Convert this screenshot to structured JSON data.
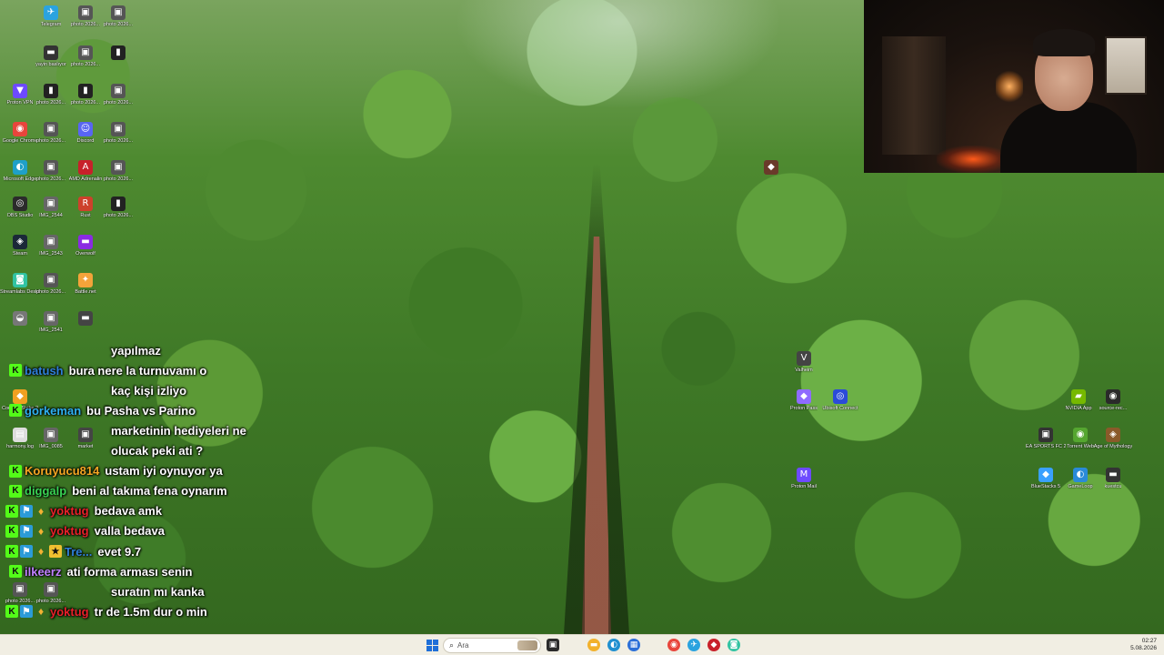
{
  "desktop": {
    "icons": [
      {
        "label": "Telegram",
        "glyph": "✈",
        "color": "#2aa3df"
      },
      {
        "label": "photo 2026...",
        "glyph": "▣",
        "color": "#555555"
      },
      {
        "label": "photo 2026...",
        "glyph": "▣",
        "color": "#555555"
      },
      {
        "label": "",
        "glyph": "▮",
        "color": "#222222"
      },
      {
        "label": "yayin baslıyor",
        "glyph": "▬",
        "color": "#333333"
      },
      {
        "label": "photo 2026...",
        "glyph": "▣",
        "color": "#555555"
      },
      {
        "label": "photo 2026...",
        "glyph": "▣",
        "color": "#555555"
      },
      {
        "label": "Proton VPN",
        "glyph": "▼",
        "color": "#6d4aff"
      },
      {
        "label": "photo 2026...",
        "glyph": "▮",
        "color": "#222222"
      },
      {
        "label": "photo 2026...",
        "glyph": "▮",
        "color": "#222222"
      },
      {
        "label": "photo 2026...",
        "glyph": "▣",
        "color": "#555555"
      },
      {
        "label": "Google Chrome",
        "glyph": "◉",
        "color": "#e8453c"
      },
      {
        "label": "photo 2026...",
        "glyph": "▣",
        "color": "#555555"
      },
      {
        "label": "Discord",
        "glyph": "☺",
        "color": "#5865f2"
      },
      {
        "label": "photo 2026...",
        "glyph": "▣",
        "color": "#555555"
      },
      {
        "label": "Microsoft Edge",
        "glyph": "◐",
        "color": "#1fa0c8"
      },
      {
        "label": "photo 2026...",
        "glyph": "▣",
        "color": "#555555"
      },
      {
        "label": "AMD Adrenalin",
        "glyph": "A",
        "color": "#c8202a"
      },
      {
        "label": "photo 2026...",
        "glyph": "▮",
        "color": "#222222"
      },
      {
        "label": "OBS Studio",
        "glyph": "◎",
        "color": "#2b2b2b"
      },
      {
        "label": "IMG_2544",
        "glyph": "▣",
        "color": "#666666"
      },
      {
        "label": "Rust",
        "glyph": "R",
        "color": "#cd412b"
      },
      {
        "label": "Steam",
        "glyph": "◈",
        "color": "#1b2838"
      },
      {
        "label": "IMG_2543",
        "glyph": "▣",
        "color": "#666666"
      },
      {
        "label": "Overwolf",
        "glyph": "▬",
        "color": "#8a2be2"
      },
      {
        "label": "Streamlabs Desktop",
        "glyph": "◙",
        "color": "#31c3a2"
      },
      {
        "label": "photo 2026...",
        "glyph": "▣",
        "color": "#555555"
      },
      {
        "label": "Battle.net",
        "glyph": "✦",
        "color": "#f3a33a"
      },
      {
        "label": "",
        "glyph": "◒",
        "color": "#777777"
      },
      {
        "label": "IMG_2541",
        "glyph": "▣",
        "color": "#666666"
      },
      {
        "label": "",
        "glyph": "▬",
        "color": "#444444"
      },
      {
        "label": "",
        "glyph": "◆",
        "color": "#6a3a2a"
      },
      {
        "label": "Valheim",
        "glyph": "V",
        "color": "#444444"
      },
      {
        "label": "Proton Pass",
        "glyph": "◆",
        "color": "#8f6bff"
      },
      {
        "label": "Ubisoft Connect",
        "glyph": "◎",
        "color": "#2b4bd8"
      },
      {
        "label": "NVIDIA App",
        "glyph": "▰",
        "color": "#76b900"
      },
      {
        "label": "source-rec...",
        "glyph": "◉",
        "color": "#2a2a2a"
      },
      {
        "label": "EA SPORTS FC 26",
        "glyph": "▣",
        "color": "#333333"
      },
      {
        "label": "Torrent Web",
        "glyph": "◉",
        "color": "#55a630"
      },
      {
        "label": "Age of Mythology",
        "glyph": "◈",
        "color": "#8a5a2a"
      },
      {
        "label": "Proton Mail",
        "glyph": "M",
        "color": "#6d4aff"
      },
      {
        "label": "BlueStacks 5",
        "glyph": "◆",
        "color": "#3aa0ff"
      },
      {
        "label": "GameLoop",
        "glyph": "◐",
        "color": "#2a8ad8"
      },
      {
        "label": "kuestcu",
        "glyph": "▬",
        "color": "#333333"
      },
      {
        "label": "harmony.log",
        "glyph": "▤",
        "color": "#dddddd"
      },
      {
        "label": "IMG_0085",
        "glyph": "▣",
        "color": "#666666"
      },
      {
        "label": "market",
        "glyph": "▣",
        "color": "#444444"
      },
      {
        "label": "Counter-Strike 2",
        "glyph": "◆",
        "color": "#f0a020"
      },
      {
        "label": "photo 2026...",
        "glyph": "▣",
        "color": "#555555"
      },
      {
        "label": "photo 2026...",
        "glyph": "▣",
        "color": "#555555"
      }
    ]
  },
  "chat": {
    "messages": [
      {
        "user": "",
        "user_color": "#ffffff",
        "badges": [],
        "text": "yapılmaz"
      },
      {
        "user": "batush",
        "user_color": "#2f7fd8",
        "badges": [
          "k"
        ],
        "text": "bura nere la turnuvamı o"
      },
      {
        "user": "",
        "user_color": "#ffffff",
        "badges": [],
        "text": "kaç kişi izliyo"
      },
      {
        "user": "gorkeman",
        "user_color": "#2fb0f0",
        "badges": [
          "k"
        ],
        "text": "bu Pasha vs Parino"
      },
      {
        "user": "",
        "user_color": "#ffffff",
        "badges": [],
        "text": "marketinin hediyeleri ne"
      },
      {
        "user": "",
        "user_color": "#ffffff",
        "badges": [],
        "text": "olucak peki ati ?"
      },
      {
        "user": "Koruyucu814",
        "user_color": "#f5a623",
        "badges": [
          "k"
        ],
        "text": "ustam iyi oynuyor ya"
      },
      {
        "user": "diggalp",
        "user_color": "#39d353",
        "badges": [
          "k"
        ],
        "text": "beni al takıma fena oynarım"
      },
      {
        "user": "yoktug",
        "user_color": "#e8202a",
        "badges": [
          "k",
          "b",
          "o"
        ],
        "text": "bedava amk"
      },
      {
        "user": "yoktug",
        "user_color": "#e8202a",
        "badges": [
          "k",
          "b",
          "o"
        ],
        "text": "valla bedava"
      },
      {
        "user": "Tre...",
        "user_color": "#2f7fd8",
        "badges": [
          "k",
          "b",
          "o",
          "y"
        ],
        "text": "evet 9.7"
      },
      {
        "user": "ilkeerz",
        "user_color": "#c080ff",
        "badges": [
          "k"
        ],
        "text": "ati forma arması senin"
      },
      {
        "user": "",
        "user_color": "#ffffff",
        "badges": [],
        "text": "suratın mı kanka"
      },
      {
        "user": "yoktug",
        "user_color": "#e8202a",
        "badges": [
          "k",
          "b",
          "o"
        ],
        "text": "tr de 1.5m dur o min"
      }
    ]
  },
  "taskbar": {
    "search_placeholder": "Ara",
    "apps": [
      {
        "name": "file-explorer",
        "glyph": "▬",
        "color": "#f2b12c"
      },
      {
        "name": "edge",
        "glyph": "◐",
        "color": "#1f8fd0"
      },
      {
        "name": "store",
        "glyph": "▦",
        "color": "#2b6fd8"
      },
      {
        "name": "chrome",
        "glyph": "◉",
        "color": "#e8453c"
      },
      {
        "name": "telegram",
        "glyph": "✈",
        "color": "#2aa3df"
      },
      {
        "name": "app-red",
        "glyph": "◆",
        "color": "#c8202a"
      },
      {
        "name": "streamlabs",
        "glyph": "◙",
        "color": "#31c3a2"
      }
    ],
    "clock": {
      "time": "02:27",
      "date": "5.08.2026"
    }
  }
}
